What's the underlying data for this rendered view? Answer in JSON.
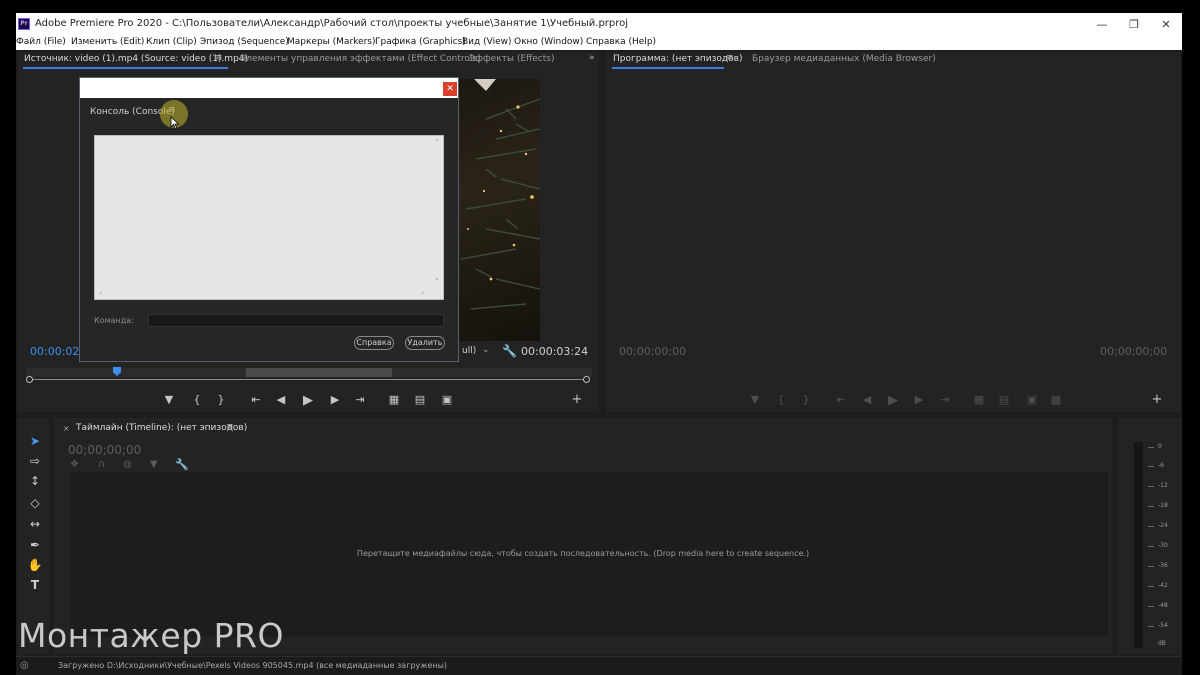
{
  "window": {
    "title": "Adobe Premiere Pro 2020 - C:\\Пользователи\\Александр\\Рабочий стол\\проекты учебные\\Занятие 1\\Учебный.prproj",
    "app_icon": "Pr"
  },
  "menu": [
    "Файл (File)",
    "Изменить (Edit)",
    "Клип (Clip)",
    "Эпизод (Sequence)",
    "Маркеры (Markers)",
    "Графика (Graphics)",
    "Вид (View)",
    "Окно (Window)",
    "Справка (Help)"
  ],
  "source_panel": {
    "tabs": [
      "Источник: video (1).mp4 (Source: video (1).mp4)",
      "Элементы управления эффектами (Effect Controls)",
      "Эффекты (Effects)"
    ],
    "timecode_left": "00:00:02:1",
    "timecode_right": "00:00:03:24",
    "fit_value": "ull)"
  },
  "program_panel": {
    "tabs": [
      "Программа: (нет эпизодов)",
      "Браузер медиаданных (Media Browser)"
    ],
    "timecode_left": "00;00;00;00",
    "timecode_right": "00;00;00;00"
  },
  "console": {
    "title": "Консоль (Console)",
    "command_label": "Команда:",
    "command_value": "",
    "help_button": "Справка",
    "delete_button": "Удалить"
  },
  "timeline": {
    "tab": "Таймлайн (Timeline): (нет эпизодов)",
    "timecode": "00;00;00;00",
    "drop_hint": "Перетащите медиафайлы сюда, чтобы создать последовательность. (Drop media here to create sequence.)"
  },
  "meter": {
    "ticks": [
      "0",
      "-6",
      "-12",
      "-18",
      "-24",
      "-30",
      "-36",
      "-42",
      "-48",
      "-54",
      "dB"
    ]
  },
  "watermark": "Монтажер PRO",
  "status": "Загружено D:\\Исходники\\Учебные\\Pexels Videos 905045.mp4 (все медиаданные загружены)",
  "colors": {
    "accent_blue": "#3c8ef0",
    "close_red": "#d9412f",
    "panel_bg": "#232323"
  }
}
